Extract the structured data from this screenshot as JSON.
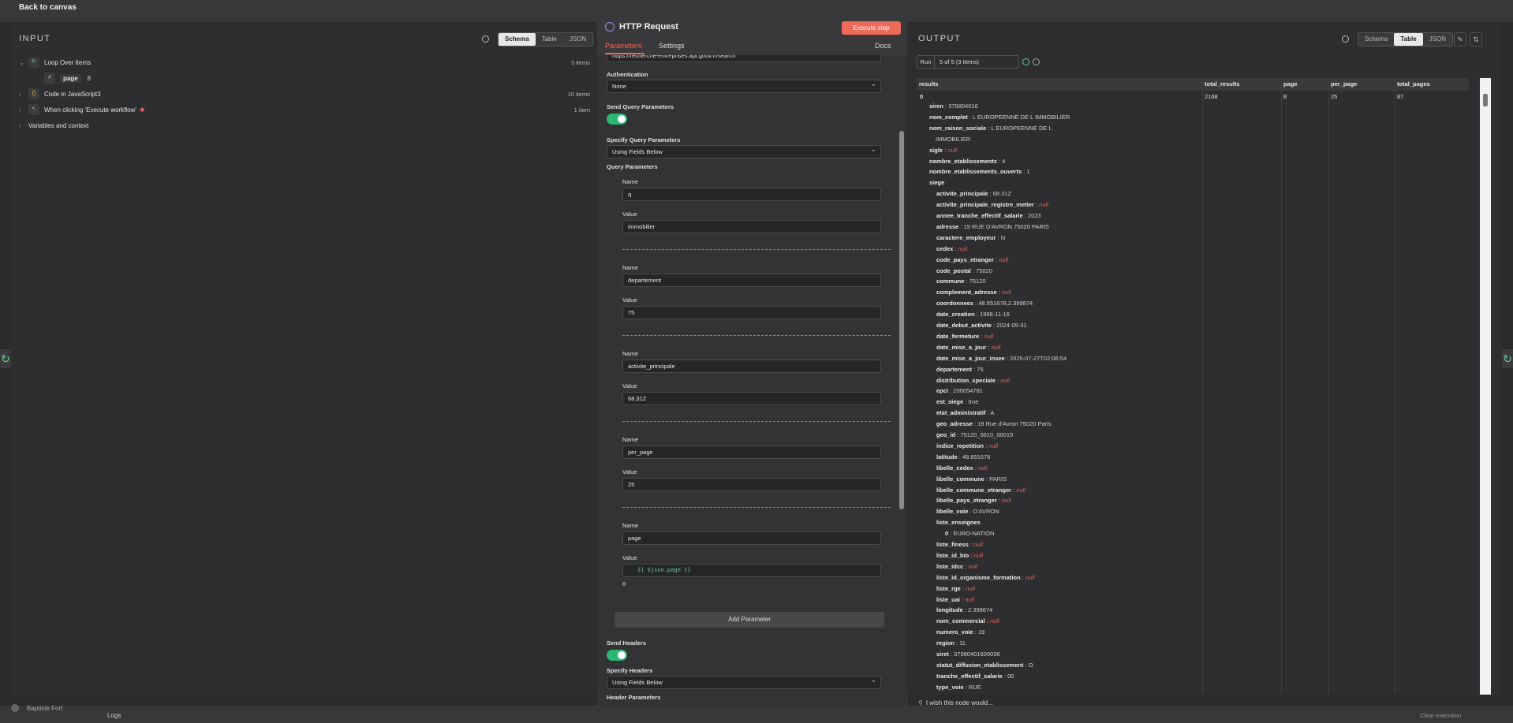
{
  "topbar": {
    "back_label": "Back to canvas"
  },
  "input_panel": {
    "title": "INPUT",
    "view_tabs": [
      "Schema",
      "Table",
      "JSON"
    ],
    "tree": [
      {
        "label": "Loop Over Items",
        "count": "3 items",
        "icon": "loop-icon"
      },
      {
        "label": "page",
        "value": "8",
        "icon": "hash-icon"
      },
      {
        "label": "Code in JavaScript3",
        "count": "10 items",
        "icon": "code-icon"
      },
      {
        "label": "When clicking 'Execute workflow'",
        "count": "1 item",
        "icon": "cursor-icon"
      },
      {
        "label": "Variables and context"
      }
    ]
  },
  "node": {
    "title": "HTTP Request",
    "execute_label": "Execute step",
    "tabs": [
      "Parameters",
      "Settings"
    ],
    "docs_label": "Docs",
    "url_value": "https://recherche-entreprises.api.gouv.fr/search",
    "auth_label": "Authentication",
    "auth_value": "None",
    "send_query_label": "Send Query Parameters",
    "specify_query_label": "Specify Query Parameters",
    "specify_query_value": "Using Fields Below",
    "query_params_label": "Query Parameters",
    "name_label": "Name",
    "value_label": "Value",
    "params": [
      {
        "name": "q",
        "value": "immobilier"
      },
      {
        "name": "departement",
        "value": "75"
      },
      {
        "name": "activite_principale",
        "value": "68.31Z"
      },
      {
        "name": "per_page",
        "value": "25"
      },
      {
        "name": "page",
        "value": "{{ $json.page }}",
        "preview": "8"
      }
    ],
    "add_param_label": "Add Parameter",
    "send_headers_label": "Send Headers",
    "specify_headers_label": "Specify Headers",
    "specify_headers_value": "Using Fields Below",
    "header_params_label": "Header Parameters"
  },
  "output_panel": {
    "title": "OUTPUT",
    "view_tabs": [
      "Schema",
      "Table",
      "JSON"
    ],
    "run_label": "Run",
    "run_value": "5 of 5 (3 items)",
    "columns": [
      "results",
      "total_results",
      "page",
      "per_page",
      "total_pages"
    ],
    "row_values": {
      "index": "0",
      "total_results": "2168",
      "page": "8",
      "per_page": "25",
      "total_pages": "87"
    },
    "top_fields": [
      {
        "k": "siren",
        "v": "379804016"
      },
      {
        "k": "nom_complet",
        "v": "L EUROPEENNE DE L IMMOBILIER"
      },
      {
        "k": "nom_raison_sociale",
        "v": "L EUROPEENNE DE L"
      },
      {
        "k": "",
        "v": "IMMOBILIER"
      },
      {
        "k": "sigle",
        "v": "null"
      },
      {
        "k": "nombre_etablissements",
        "v": "4"
      },
      {
        "k": "nombre_etablissements_ouverts",
        "v": "1"
      },
      {
        "k": "siege",
        "v": ""
      }
    ],
    "siege_fields": [
      {
        "k": "activite_principale",
        "v": "68.31Z"
      },
      {
        "k": "activite_principale_registre_metier",
        "v": "null"
      },
      {
        "k": "annee_tranche_effectif_salarie",
        "v": "2023"
      },
      {
        "k": "adresse",
        "v": "19 RUE D'AVRON 75020 PARIS"
      },
      {
        "k": "caractere_employeur",
        "v": "N"
      },
      {
        "k": "cedex",
        "v": "null"
      },
      {
        "k": "code_pays_etranger",
        "v": "null"
      },
      {
        "k": "code_postal",
        "v": "75020"
      },
      {
        "k": "commune",
        "v": "75120"
      },
      {
        "k": "complement_adresse",
        "v": "null"
      },
      {
        "k": "coordonnees",
        "v": "48.851678,2.399874"
      },
      {
        "k": "date_creation",
        "v": "1998-11-16"
      },
      {
        "k": "date_debut_activite",
        "v": "2024-05-31"
      },
      {
        "k": "date_fermeture",
        "v": "null"
      },
      {
        "k": "date_mise_a_jour",
        "v": "null"
      },
      {
        "k": "date_mise_a_jour_insee",
        "v": "2025-07-27T02:06:54"
      },
      {
        "k": "departement",
        "v": "75"
      },
      {
        "k": "distribution_speciale",
        "v": "null"
      },
      {
        "k": "epci",
        "v": "200054781"
      },
      {
        "k": "est_siege",
        "v": "true"
      },
      {
        "k": "etat_administratif",
        "v": "A"
      },
      {
        "k": "geo_adresse",
        "v": "19 Rue d'Avron 75020 Paris"
      },
      {
        "k": "geo_id",
        "v": "75120_0610_00019"
      },
      {
        "k": "indice_repetition",
        "v": "null"
      },
      {
        "k": "latitude",
        "v": "48.851678"
      },
      {
        "k": "libelle_cedex",
        "v": "null"
      },
      {
        "k": "libelle_commune",
        "v": "PARIS"
      },
      {
        "k": "libelle_commune_etranger",
        "v": "null"
      },
      {
        "k": "libelle_pays_etranger",
        "v": "null"
      },
      {
        "k": "libelle_voie",
        "v": "D'AVRON"
      },
      {
        "k": "liste_enseignes",
        "v": ""
      },
      {
        "k": "0",
        "v": "EURO-NATION",
        "indent": true
      },
      {
        "k": "liste_finess",
        "v": "null"
      },
      {
        "k": "liste_id_bio",
        "v": "null"
      },
      {
        "k": "liste_idcc",
        "v": "null"
      },
      {
        "k": "liste_id_organisme_formation",
        "v": "null"
      },
      {
        "k": "liste_rge",
        "v": "null"
      },
      {
        "k": "liste_uai",
        "v": "null"
      },
      {
        "k": "longitude",
        "v": "2.399874"
      },
      {
        "k": "nom_commercial",
        "v": "null"
      },
      {
        "k": "numero_voie",
        "v": "19"
      },
      {
        "k": "region",
        "v": "11"
      },
      {
        "k": "siret",
        "v": "37980401600036"
      },
      {
        "k": "statut_diffusion_etablissement",
        "v": "O"
      },
      {
        "k": "tranche_effectif_salarie",
        "v": "00"
      },
      {
        "k": "type_voie",
        "v": "RUE"
      }
    ],
    "footer_hint": "I wish this node would..."
  },
  "bottom": {
    "user_name": "Baptiste Fort",
    "logs_label": "Logs",
    "clear_label": "Clear execution"
  },
  "colors": {
    "accent": "#ee6a5a",
    "toggle_on": "#2bb673",
    "null": "#e0625a"
  }
}
